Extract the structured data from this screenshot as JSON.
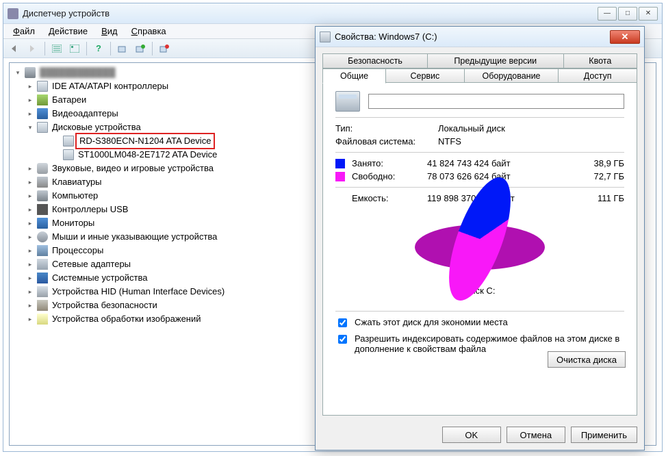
{
  "dm": {
    "title": "Диспетчер устройств",
    "menu": {
      "file": "Файл",
      "action": "Действие",
      "view": "Вид",
      "help": "Справка"
    },
    "root_blurred": "████████████",
    "items": [
      {
        "label": "IDE ATA/ATAPI контроллеры",
        "icon": "ic-drive"
      },
      {
        "label": "Батареи",
        "icon": "ic-batt"
      },
      {
        "label": "Видеоадаптеры",
        "icon": "ic-display"
      },
      {
        "label": "Дисковые устройства",
        "icon": "ic-drive",
        "expanded": true,
        "children": [
          {
            "label": "RD-S380ECN-N1204 ATA Device",
            "highlighted": true
          },
          {
            "label": "ST1000LM048-2E7172 ATA Device"
          }
        ]
      },
      {
        "label": "Звуковые, видео и игровые устройства",
        "icon": "ic-sound"
      },
      {
        "label": "Клавиатуры",
        "icon": "ic-keyboard"
      },
      {
        "label": "Компьютер",
        "icon": "ic-computer"
      },
      {
        "label": "Контроллеры USB",
        "icon": "ic-usb"
      },
      {
        "label": "Мониторы",
        "icon": "ic-display"
      },
      {
        "label": "Мыши и иные указывающие устройства",
        "icon": "ic-mouse"
      },
      {
        "label": "Процессоры",
        "icon": "ic-cpu"
      },
      {
        "label": "Сетевые адаптеры",
        "icon": "ic-net"
      },
      {
        "label": "Системные устройства",
        "icon": "ic-sys"
      },
      {
        "label": "Устройства HID (Human Interface Devices)",
        "icon": "ic-hid"
      },
      {
        "label": "Устройства безопасности",
        "icon": "ic-sec"
      },
      {
        "label": "Устройства обработки изображений",
        "icon": "ic-img"
      }
    ]
  },
  "prop": {
    "title": "Свойства: Windows7 (C:)",
    "tabs_back": {
      "security": "Безопасность",
      "prev": "Предыдущие версии",
      "quota": "Квота"
    },
    "tabs_front": {
      "general": "Общие",
      "tools": "Сервис",
      "hardware": "Оборудование",
      "sharing": "Доступ"
    },
    "name_value": "",
    "type_label": "Тип:",
    "type_value": "Локальный диск",
    "fs_label": "Файловая система:",
    "fs_value": "NTFS",
    "used_label": "Занято:",
    "used_bytes": "41 824 743 424 байт",
    "used_size": "38,9 ГБ",
    "free_label": "Свободно:",
    "free_bytes": "78 073 626 624 байт",
    "free_size": "72,7 ГБ",
    "cap_label": "Емкость:",
    "cap_bytes": "119 898 370 048 байт",
    "cap_size": "111 ГБ",
    "disk_caption": "Диск C:",
    "cleanup": "Очистка диска",
    "chk_compress": "Сжать этот диск для экономии места",
    "chk_index": "Разрешить индексировать содержимое файлов на этом диске в дополнение к свойствам файла",
    "ok": "OK",
    "cancel": "Отмена",
    "apply": "Применить"
  },
  "chart_data": {
    "type": "pie",
    "title": "Диск C:",
    "series": [
      {
        "name": "Занято",
        "value_bytes": 41824743424,
        "value_gb": 38.9,
        "color": "#0018f8"
      },
      {
        "name": "Свободно",
        "value_bytes": 78073626624,
        "value_gb": 72.7,
        "color": "#f818f8"
      }
    ],
    "total_bytes": 119898370048,
    "total_gb": 111
  }
}
